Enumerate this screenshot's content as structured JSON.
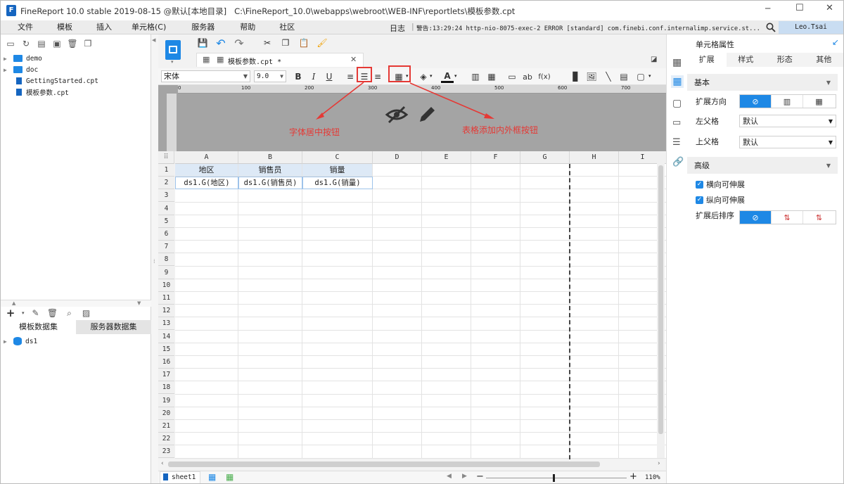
{
  "window": {
    "title": "FineReport 10.0 stable 2019-08-15 @默认[本地目录]   C:\\FineReport_10.0\\webapps\\webroot\\WEB-INF\\reportlets\\模板参数.cpt",
    "controls": {
      "minimize": "─",
      "maximize": "☐",
      "close": "✕"
    }
  },
  "menu": {
    "items": [
      "文件",
      "模板",
      "插入",
      "单元格(C)",
      "服务器",
      "帮助",
      "社区"
    ],
    "log_label": "日志",
    "warning_text": "警告:13:29:24 http-nio-8075-exec-2 ERROR [standard] com.finebi.conf.internalimp.service.st...",
    "user": "Leo.Tsai"
  },
  "tree": {
    "items": [
      {
        "label": "demo",
        "kind": "folder"
      },
      {
        "label": "doc",
        "kind": "folder"
      },
      {
        "label": "GettingStarted.cpt",
        "kind": "file"
      },
      {
        "label": "模板参数.cpt",
        "kind": "file"
      }
    ]
  },
  "dataset": {
    "tabs": [
      "模板数据集",
      "服务器数据集"
    ],
    "items": [
      "ds1"
    ]
  },
  "editor": {
    "tab_label": "模板参数.cpt *",
    "font_name": "宋体",
    "font_size": "9.0",
    "ruler_ticks": [
      "0",
      "100",
      "200",
      "300",
      "400",
      "500",
      "600",
      "700"
    ]
  },
  "grid": {
    "columns": [
      "A",
      "B",
      "C",
      "D",
      "E",
      "F",
      "G",
      "H",
      "I"
    ],
    "rows": [
      "1",
      "2",
      "3",
      "4",
      "5",
      "6",
      "7",
      "8",
      "9",
      "10",
      "11",
      "12",
      "13",
      "14",
      "15",
      "16",
      "17",
      "18",
      "19",
      "20",
      "21",
      "22",
      "23"
    ],
    "header_cells": [
      "地区",
      "销售员",
      "销量"
    ],
    "data_cells": [
      "ds1.G(地区)",
      "ds1.G(销售员)",
      "ds1.G(销量)"
    ]
  },
  "annotations": {
    "center_align": "字体居中按钮",
    "border": "表格添加内外框按钮",
    "color": "#e53935"
  },
  "status": {
    "sheet": "sheet1",
    "zoom": "110%",
    "zoom_minus": "−",
    "zoom_plus": "+"
  },
  "props": {
    "title": "单元格属性",
    "tabs": [
      "扩展",
      "样式",
      "形态",
      "其他"
    ],
    "basic_section": "基本",
    "expand_direction_label": "扩展方向",
    "left_parent_label": "左父格",
    "left_parent_value": "默认",
    "up_parent_label": "上父格",
    "up_parent_value": "默认",
    "advanced_section": "高级",
    "h_expand_label": "横向可伸展",
    "v_expand_label": "纵向可伸展",
    "sort_label": "扩展后排序"
  },
  "colors": {
    "accent": "#1e88e5",
    "header_bg": "#dde9f6",
    "ruler_bg": "#a0a0a0"
  }
}
